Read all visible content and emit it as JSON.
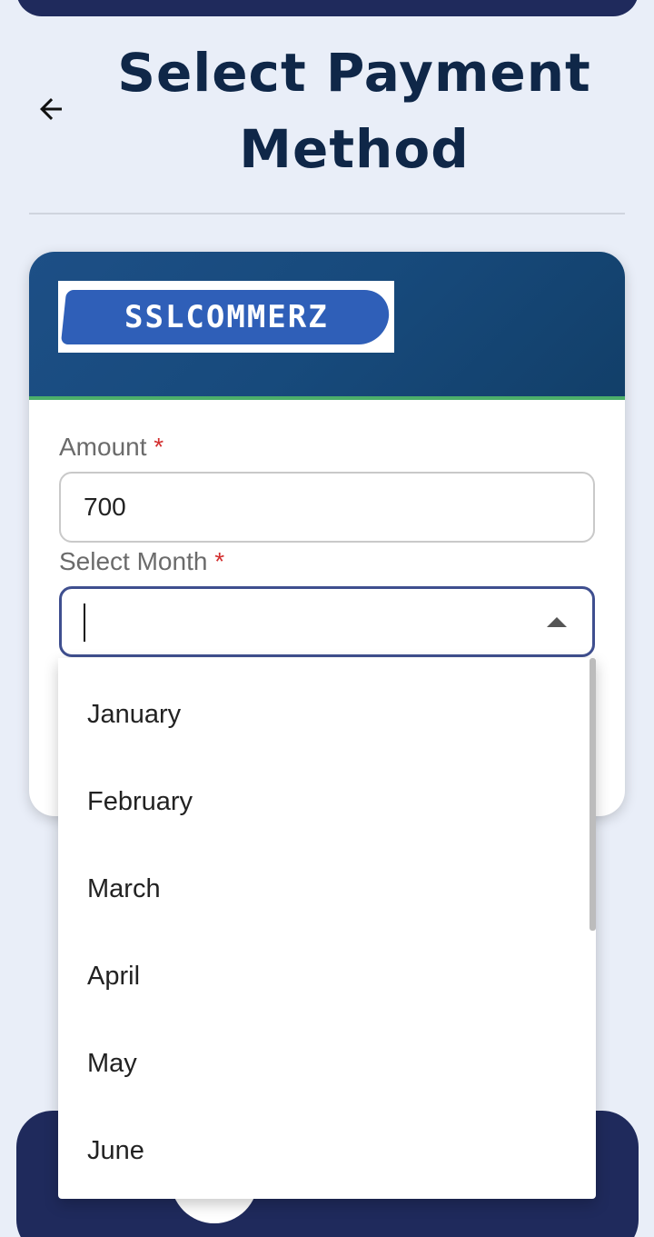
{
  "header": {
    "title": "Select Payment Method",
    "back_icon": "arrow-left-icon"
  },
  "card": {
    "logo_text": "SSLCOMMERZ",
    "brand_colors": {
      "header_gradient": "#1d4f86",
      "accent_line": "#4caf6a",
      "logo_pill": "#2f5fb8"
    }
  },
  "form": {
    "amount_label": "Amount",
    "amount_value": "700",
    "month_label": "Select Month",
    "month_value": "",
    "required_mark": "*"
  },
  "month_options": [
    "January",
    "February",
    "March",
    "April",
    "May",
    "June"
  ],
  "colors": {
    "primary_dark": "#1f2a5c",
    "title": "#0f2748",
    "required": "#d32f2f"
  }
}
